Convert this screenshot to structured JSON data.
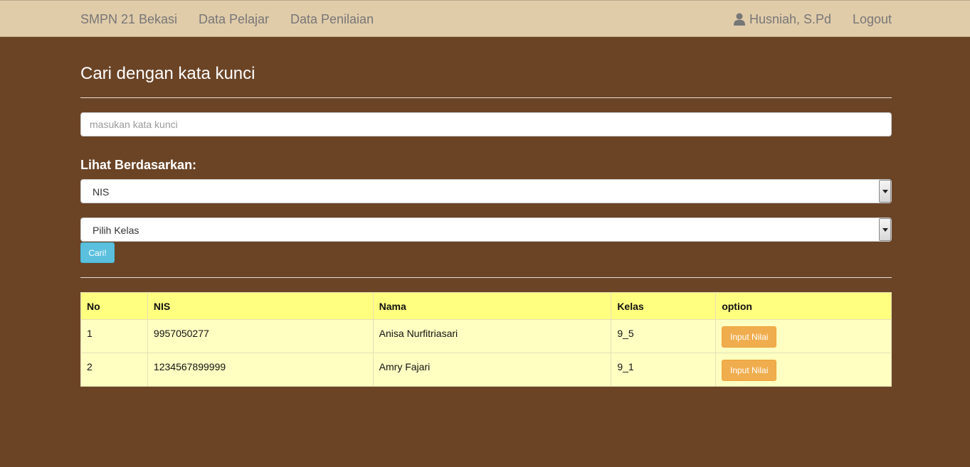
{
  "navbar": {
    "brand": "SMPN 21 Bekasi",
    "links": [
      "Data Pelajar",
      "Data Penilaian"
    ],
    "user_name": "Husniah, S.Pd",
    "logout": "Logout"
  },
  "page": {
    "title": "Cari dengan kata kunci",
    "search_placeholder": "masukan kata kunci",
    "filter_label": "Lihat Berdasarkan:",
    "filter_by_value": "NIS",
    "class_value": "Pilih Kelas",
    "search_button": "Cari!"
  },
  "table": {
    "headers": [
      "No",
      "NIS",
      "Nama",
      "Kelas",
      "option"
    ],
    "rows": [
      {
        "no": "1",
        "nis": "9957050277",
        "nama": "Anisa Nurfitriasari",
        "kelas": "9_5",
        "action": "Input Nilai"
      },
      {
        "no": "2",
        "nis": "1234567899999",
        "nama": "Amry Fajari",
        "kelas": "9_1",
        "action": "Input Nilai"
      }
    ]
  },
  "colors": {
    "background": "#6b4426",
    "navbar": "#e1ccaa",
    "table_header": "#ffff80",
    "table_row": "#ffffc2",
    "search_button": "#5bc0de",
    "action_button": "#f0ad4e"
  },
  "icons": {
    "user": "user-icon",
    "dropdown": "chevron-down-icon"
  }
}
